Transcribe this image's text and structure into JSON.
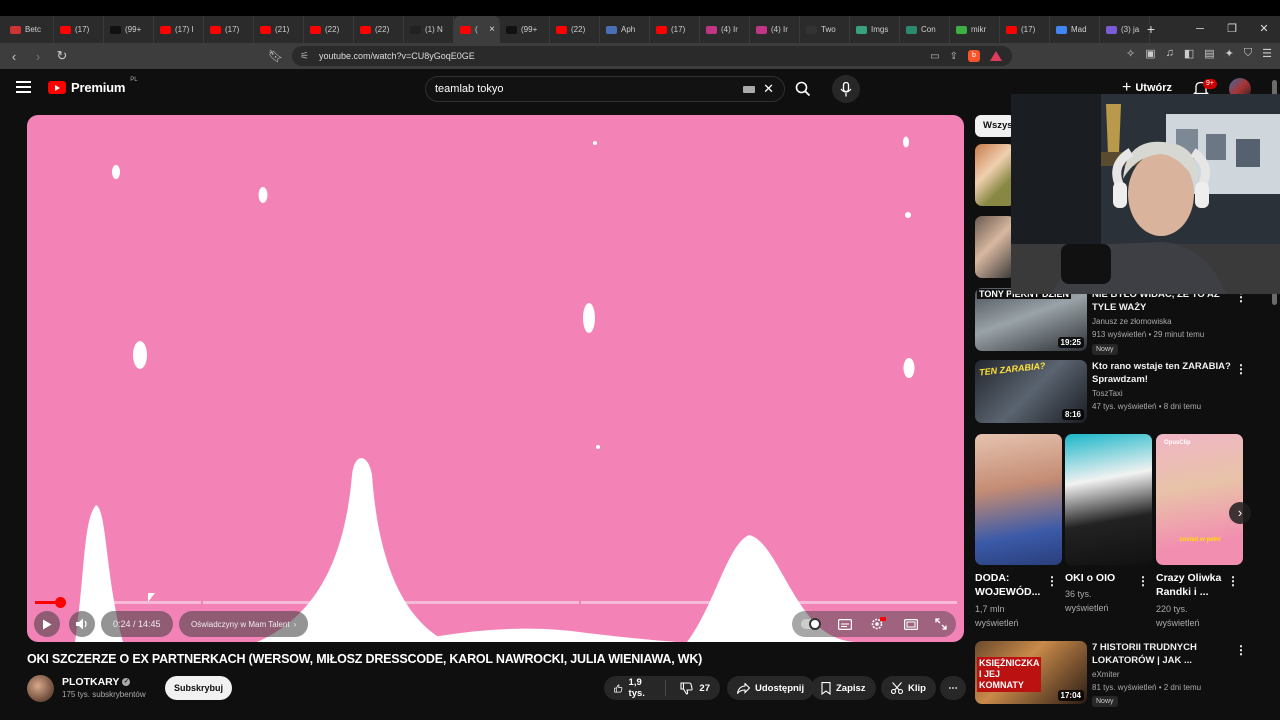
{
  "browser": {
    "tabs": [
      {
        "label": "Betc",
        "fav": "#c33"
      },
      {
        "label": "(17)",
        "fav": "#ff0000"
      },
      {
        "label": "(99+",
        "fav": "#111"
      },
      {
        "label": "(17) I",
        "fav": "#ff0000"
      },
      {
        "label": "(17)",
        "fav": "#ff0000"
      },
      {
        "label": "(21)",
        "fav": "#ff0000"
      },
      {
        "label": "(22)",
        "fav": "#ff0000"
      },
      {
        "label": "(22)",
        "fav": "#ff0000"
      },
      {
        "label": "(1) N",
        "fav": "#222"
      },
      {
        "label": "(",
        "fav": "#ff0000",
        "active": true
      },
      {
        "label": "(99+",
        "fav": "#111"
      },
      {
        "label": "(22)",
        "fav": "#ff0000"
      },
      {
        "label": "Aph",
        "fav": "#4b6fb5"
      },
      {
        "label": "(17)",
        "fav": "#ff0000"
      },
      {
        "label": "(4) Ir",
        "fav": "#c13584"
      },
      {
        "label": "(4) Ir",
        "fav": "#c13584"
      },
      {
        "label": "Two",
        "fav": "#333"
      },
      {
        "label": "Imgs",
        "fav": "#3aa17e"
      },
      {
        "label": "Con",
        "fav": "#2b8a6e"
      },
      {
        "label": "mikr",
        "fav": "#3cb043"
      },
      {
        "label": "(17)",
        "fav": "#ff0000"
      },
      {
        "label": "Mad",
        "fav": "#4285f4"
      },
      {
        "label": "(3) ja",
        "fav": "#7b5cd6"
      }
    ],
    "url": "youtube.com/watch?v=CU8yGoqE0GE"
  },
  "header": {
    "logo_word": "Premium",
    "logo_region": "PL",
    "search_value": "teamlab tokyo",
    "create_label": "Utwórz",
    "bell_badge": "9+"
  },
  "player": {
    "time": "0:24 / 14:45",
    "chapter": "Oświadczyny w Mam Talent",
    "progress_fraction": 0.027
  },
  "video": {
    "title": "OKI SZCZERZE O EX PARTNERKACH (WERSOW, MIŁOSZ DRESSCODE, KAROL NAWROCKI, JULIA WIENIAWA, WK)",
    "channel": "PLOTKARY",
    "subscribers": "175 tys. subskrybentów",
    "subscribe_label": "Subskrybuj",
    "likes": "1,9 tys.",
    "dislikes": "27",
    "share_label": "Udostępnij",
    "save_label": "Zapisz",
    "clip_label": "Klip"
  },
  "sidebar": {
    "chip_label": "Wszys",
    "videos": [
      {
        "thumb_text": "TONY PIEKNY DZIEN",
        "duration": "19:25",
        "title_line1": "NIE BYŁO WIDAĆ, ŻE TO AŻ",
        "title_line2": "TYLE WAŻY",
        "channel": "Janusz ze złomowiska",
        "meta": "913 wyświetleń • 29 minut temu",
        "badge": "Nowy"
      },
      {
        "thumb_text": "TEN ZARABIA?",
        "duration": "8:16",
        "title_line1": "Kto rano wstaje ten ZARABIA?",
        "title_line2": "Sprawdzam!",
        "channel": "ToszTaxi",
        "meta": "47 tys. wyświetleń • 8 dni temu"
      },
      {
        "thumb_text": "KSIĘŻNICZKA I JEJ KOMNATY",
        "duration": "17:04",
        "title_line1": "7 HISTORII TRUDNYCH",
        "title_line2": "LOKATORÓW | JAK ...",
        "channel": "eXmiter",
        "meta": "81 tys. wyświetleń • 2 dni temu",
        "badge": "Nowy"
      }
    ],
    "shorts": [
      {
        "title_line1": "DODA:",
        "title_line2": "WOJEWÓD...",
        "meta_line1": "1,7 mln",
        "meta_line2": "wyświetleń"
      },
      {
        "title_line1": "OKI o OIO",
        "meta_line1": "36 tys.",
        "meta_line2": "wyświetleń"
      },
      {
        "title_line1": "Crazy Oliwka",
        "title_line2": "Randki i ...",
        "meta_line1": "220 tys.",
        "meta_line2": "wyświetleń",
        "thumb_caption": "zostań w pełni"
      }
    ],
    "shorts_badge": "OpusClip"
  }
}
